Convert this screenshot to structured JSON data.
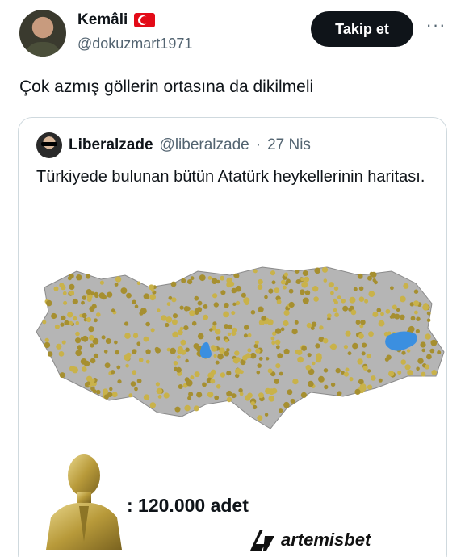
{
  "header": {
    "display_name": "Kemâli",
    "flag_icon": "turkey-flag-icon",
    "handle": "@dokuzmart1971",
    "follow_label": "Takip et",
    "more_label": "···"
  },
  "tweet": {
    "text": "Çok azmış göllerin ortasına da dikilmeli"
  },
  "quote": {
    "name": "Liberalzade",
    "handle": "@liberalzade",
    "separator": "·",
    "date": "27 Nis",
    "text": "Türkiyede bulunan bütün Atatürk heykellerinin haritası.",
    "image": {
      "count_label": ": 120.000 adet"
    }
  },
  "watermark": {
    "text": "artemisbet"
  },
  "colors": {
    "follow_bg": "#0f1419",
    "secondary_text": "#536471",
    "map_land": "#b5b5b5",
    "statue_gold": "#c9b24a",
    "lake_blue": "#3b8fe0"
  }
}
